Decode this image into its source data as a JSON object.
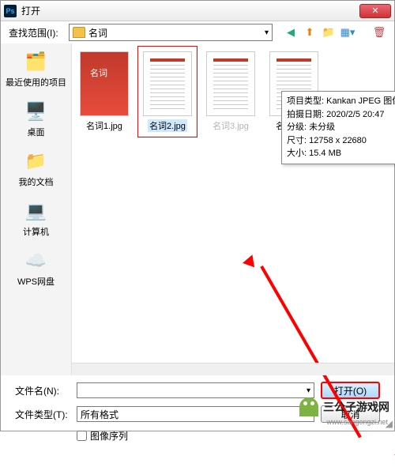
{
  "title": "打开",
  "lookin_label": "查找范围(I):",
  "lookin_value": "名词",
  "places": [
    {
      "label": "最近使用的项目",
      "icon": "🗂️"
    },
    {
      "label": "桌面",
      "icon": "🖥️"
    },
    {
      "label": "我的文档",
      "icon": "📁"
    },
    {
      "label": "计算机",
      "icon": "💻"
    },
    {
      "label": "WPS网盘",
      "icon": "☁️"
    }
  ],
  "files": [
    {
      "name": "名词1.jpg"
    },
    {
      "name": "名词2.jpg"
    },
    {
      "name": "名词3.jpg"
    },
    {
      "name": "名词4.jpg"
    }
  ],
  "tooltip": {
    "type_label": "项目类型:",
    "type_value": "Kankan JPEG 图像",
    "date_label": "拍摄日期:",
    "date_value": "2020/2/5 20:47",
    "rating_label": "分级:",
    "rating_value": "未分级",
    "dim_label": "尺寸:",
    "dim_value": "12758 x 22680",
    "size_label": "大小:",
    "size_value": "15.4 MB"
  },
  "filename_label": "文件名(N):",
  "filename_value": "",
  "filetype_label": "文件类型(T):",
  "filetype_value": "所有格式",
  "open_btn": "打开(O)",
  "cancel_btn": "取消",
  "image_seq_label": "图像序列",
  "watermark_text": "三公子游戏网",
  "watermark_url": "www.sangongzi.net"
}
